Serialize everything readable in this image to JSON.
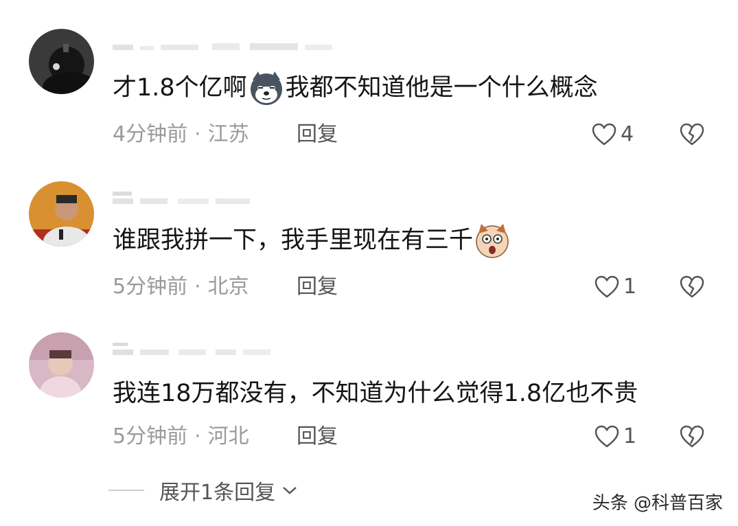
{
  "comments": [
    {
      "text_before": "才1.8个亿啊",
      "emoji": "husky-emoji",
      "text_after": "我都不知道他是一个什么概念",
      "time": "4分钟前",
      "separator": "·",
      "location": "江苏",
      "reply_label": "回复",
      "likes": "4"
    },
    {
      "text_before": "谁跟我拼一下，我手里现在有三千",
      "emoji": "shocked-dog-emoji",
      "text_after": "",
      "time": "5分钟前",
      "separator": "·",
      "location": "北京",
      "reply_label": "回复",
      "likes": "1"
    },
    {
      "text_before": "我连18万都没有，不知道为什么觉得1.8亿也不贵",
      "emoji": "",
      "text_after": "",
      "time": "5分钟前",
      "separator": "·",
      "location": "河北",
      "reply_label": "回复",
      "likes": "1"
    }
  ],
  "expand_replies": {
    "label": "展开1条回复"
  },
  "watermark": {
    "text": "头条 @科普百家"
  },
  "colors": {
    "text": "#151515",
    "meta": "#9a9a9a",
    "action": "#555555"
  },
  "icons": [
    "heart-icon",
    "broken-heart-icon",
    "chevron-down-icon"
  ]
}
